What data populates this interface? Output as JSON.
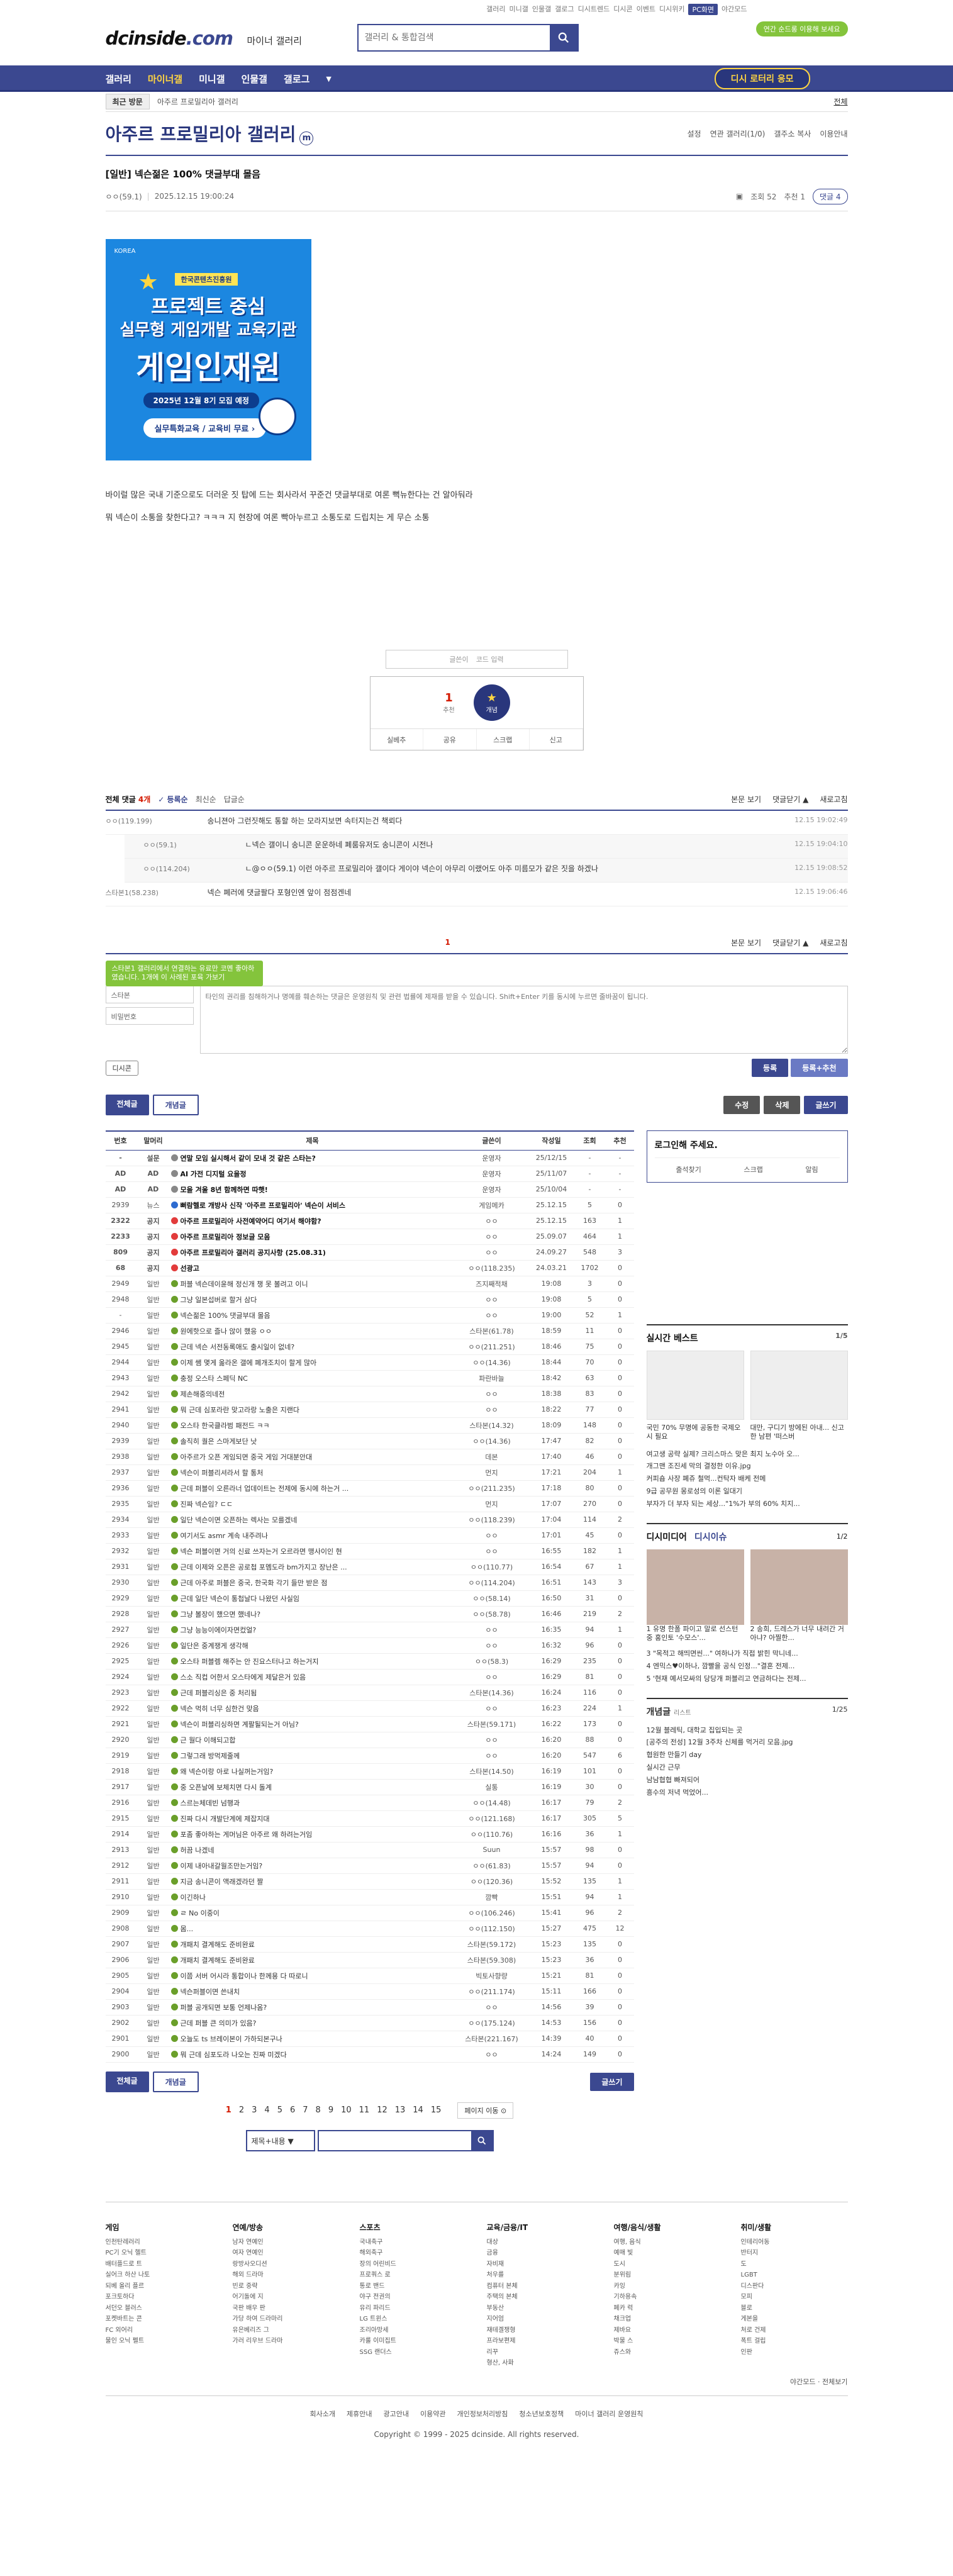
{
  "toplinks": [
    "갤러리",
    "미니갤",
    "인물갤",
    "갤로그",
    "디시트렌드",
    "디시콘",
    "이벤트",
    "디시위키",
    "PC화면",
    "야간모드"
  ],
  "header": {
    "logo_main": "dcinside",
    "logo_dot": ".com",
    "logo_sub": "마이너 갤러리",
    "search_placeholder": "갤러리 & 통합검색",
    "promo": "연간 순드롱 이용해 보세요"
  },
  "gnb": {
    "items": [
      "갤러리",
      "마이너갤",
      "미니갤",
      "인물갤",
      "갤로그"
    ],
    "active": 1,
    "more": "▼",
    "lottery": "디시 로터리 응모"
  },
  "visit": {
    "recent": "최근 방문",
    "crumb": "아주르 프로밀리아 갤러리",
    "all": "전체"
  },
  "gallery": {
    "title": "아주르 프로밀리아 갤러리",
    "mini": "m",
    "opts": [
      "설정",
      "연관 갤러리(1/0)",
      "갤주소 복사",
      "이용안내"
    ]
  },
  "post": {
    "title": "[일반] 넥슨젊은 100% 댓글부대 몰음",
    "author": "ㅇㅇ(59.1)",
    "date": "2025.12.15 19:00:24",
    "views": "조회 52",
    "recommend": "추천 1",
    "comment_btn": "댓글 4",
    "body": [
      "바이럴 많은 국내 기준으로도 더러운 짓 탑에 드는 회사라서 꾸준건 댓글부대로 여론 뻑뉴한다는 건 알아둬라",
      "뭐 넥슨이 소통을 찾한다고? ㅋㅋㅋ 지 현장에 여론 빡아누르고 소통도로 드립치는 게 무슨 소통"
    ]
  },
  "banner": {
    "org": "KOREA",
    "tag": "한국콘텐츠진흥원",
    "line1": "프로젝트 중심",
    "line2": "실무형 게임개발 교육기관",
    "line3": "게임인재원",
    "line4": "2025년 12월 8기 모집 예정",
    "line5": "실무특화교육 / 교육비 무료 ›"
  },
  "rec": {
    "writer": "글쓴이",
    "code": "코드 입력",
    "count": "1",
    "count_label": "추천",
    "fixed": "개념",
    "fixed_icon": "★",
    "actions": [
      "실베추",
      "공유",
      "스크랩",
      "신고"
    ]
  },
  "comments": {
    "label": "전체 댓글",
    "count": "4개",
    "tabs": [
      "✓ 등록순",
      "최신순",
      "답글순"
    ],
    "right": [
      "본문 보기",
      "댓글닫기 ▲",
      "새로고침"
    ],
    "items": [
      {
        "nick": "ㅇㅇ(119.199)",
        "text": "송니젼아 그런짓해도 통할 하는 모라지보면 속터지는건 책뢰다",
        "date": "12.15 19:02:49",
        "level": 0
      },
      {
        "nick": "ㅇㅇ(59.1)",
        "text": "ㄴ넥슨 갤이니 송니콘 운운하네 폐룸유저도 송니콘이 시전나",
        "date": "12.15 19:04:10",
        "level": 1
      },
      {
        "nick": "ㅇㅇ(114.204)",
        "text": "ㄴ@ㅇㅇ(59.1) 이런 아주르 프로밀리아 갤이다 게이야 넥슨이 아무리 이랬어도 아주 미름모가 같은 짓을 하겠나",
        "date": "12.15 19:08:52",
        "level": 1
      },
      {
        "nick": "스타본1(58.238)",
        "text": "넥슨 폐러에 댓글팔다 포형인엔 앞이 점점겐네",
        "date": "12.15 19:06:46",
        "level": 0
      }
    ],
    "page": "1",
    "tip": "스타본1 갤러리에서 연결하는 유료만 코멘 좋아하였습니다. 1개에 이 사례된 포육 가보기",
    "nick_placeholder": "스타본",
    "pw_placeholder": "비밀번호",
    "textarea": "타인의 권리를 침해하거나 명예를 훼손하는 댓글은 운영원칙 및 관련 법률에 제재를 받을 수 있습니다. Shift+Enter 키를 동시에 누르면 줄바꿈이 됩니다.",
    "dccon": "디시콘",
    "submit": "등록",
    "submit_rec": "등록+추천"
  },
  "listbtns": {
    "all": "전체글",
    "concept": "개념글",
    "modify": "수정",
    "delete": "삭제",
    "write": "글쓰기"
  },
  "table": {
    "headers": [
      "번호",
      "말머리",
      "제목",
      "글쓴이",
      "작성일",
      "조회",
      "추천"
    ],
    "rows": [
      [
        "-",
        "설문",
        "연말 모임 실시해서 같이 모내 것 같은 스타는?",
        "운영자",
        "25/12/15",
        "-",
        "-",
        "p",
        true
      ],
      [
        "AD",
        "AD",
        "AI 가전 디지털 요을정",
        "운영자",
        "25/11/07",
        "-",
        "-",
        "p",
        true
      ],
      [
        "AD",
        "AD",
        "모을 겨울 8년 함께하면 따햇!",
        "운영자",
        "25/10/04",
        "-",
        "-",
        "p",
        true
      ],
      [
        "2939",
        "뉴스",
        "뻐람헬로 개방사 신작 '아주르 프로밀리아' 넥슨이 서비스",
        "게임메카",
        "25.12.15",
        "5",
        "0",
        "n",
        true
      ],
      [
        "2322",
        "공지",
        "아주르 프로밀리아 사전예약어디 여기서 해야함?",
        "ㅇㅇ",
        "25.12.15",
        "163",
        "1",
        "r",
        true
      ],
      [
        "2233",
        "공지",
        "아주르 프로밀리아 정보글 모음",
        "ㅇㅇ",
        "25.09.07",
        "464",
        "1",
        "r",
        true
      ],
      [
        "809",
        "공지",
        "아주르 프로밀리아 갤러리 공지사항 (25.08.31)",
        "ㅇㅇ",
        "24.09.27",
        "548",
        "3",
        "r",
        true
      ],
      [
        "68",
        "공지",
        "선광고",
        "ㅇㅇ(118.235)",
        "24.03.21",
        "1702",
        "0",
        "r",
        true
      ],
      [
        "2949",
        "일반",
        "퍼블 넥슨데이윤해 정신개 챙 못 볼려고 이니",
        "즈지째적채",
        "19:08",
        "3",
        "0",
        "h",
        false
      ],
      [
        "2948",
        "일반",
        "그냥 일본섭버로 할거 삼다",
        "ㅇㅇ",
        "19:08",
        "5",
        "0",
        "h",
        false
      ],
      [
        "-",
        "일반",
        "넥슨젊은 100% 댓글부대 몰음",
        "ㅇㅇ",
        "19:00",
        "52",
        "1",
        "h",
        false
      ],
      [
        "2946",
        "일반",
        "원에핫으로 즐나 않이 했응 ㅇㅇ",
        "스타본(61.78)",
        "18:59",
        "11",
        "0",
        "h",
        false
      ],
      [
        "2945",
        "일반",
        "근데 넥슨 서전동록애도 출시일이 없네?",
        "ㅇㅇ(211.251)",
        "18:46",
        "75",
        "0",
        "h",
        false
      ],
      [
        "2944",
        "일반",
        "이제 쌤 몇게 옮라온 갤에 폐개조치이 할게 많아",
        "ㅇㅇ(14.36)",
        "18:44",
        "70",
        "0",
        "h",
        false
      ],
      [
        "2943",
        "일반",
        "충정 오스타 스페딕 NC",
        "파란바늘",
        "18:42",
        "63",
        "0",
        "h",
        false
      ],
      [
        "2942",
        "일반",
        "제손해중의네전",
        "ㅇㅇ",
        "18:38",
        "83",
        "0",
        "h",
        false
      ],
      [
        "2941",
        "일반",
        "뭐 근데 심포라란 맞고라랑 노출은 지랜다",
        "ㅇㅇ",
        "18:22",
        "77",
        "0",
        "h",
        false
      ],
      [
        "2940",
        "일반",
        "오스타 한국클라범 패전드 ㅋㅋ",
        "스타본(14.32)",
        "18:09",
        "148",
        "0",
        "h",
        false
      ],
      [
        "2939",
        "일반",
        "솔직히 퀄은 스마게보단 낫",
        "ㅇㅇ(14.36)",
        "17:47",
        "82",
        "0",
        "h",
        false
      ],
      [
        "2938",
        "일반",
        "아주르가 오픈 게임되면 중국 게임 거대분안대",
        "데본",
        "17:40",
        "46",
        "0",
        "h",
        false
      ],
      [
        "2937",
        "일반",
        "넥슨이 퍼블리셔라서 할 통처",
        "먼지",
        "17:21",
        "204",
        "1",
        "h",
        false
      ],
      [
        "2936",
        "일반",
        "근데 퍼블이 오른라너 업데이트는 전제에 동시에 하는거 ...",
        "ㅇㅇ(211.235)",
        "17:18",
        "80",
        "0",
        "h",
        false
      ],
      [
        "2935",
        "일반",
        "진짜 넥슨임? ㄷㄷ",
        "먼지",
        "17:07",
        "270",
        "0",
        "h",
        false
      ],
      [
        "2934",
        "일반",
        "일단 넥슨이면 오픈하는 렉사는 모를겠네",
        "ㅇㅇ(118.239)",
        "17:04",
        "114",
        "2",
        "h",
        false
      ],
      [
        "2933",
        "일반",
        "여기서도 asmr 계속 내주려나",
        "ㅇㅇ",
        "17:01",
        "45",
        "0",
        "h",
        false
      ],
      [
        "2932",
        "일반",
        "넥슨 퍼블이면 거의 신료 쓰자는거 오르라면 맹사이인 현",
        "ㅇㅇ",
        "16:55",
        "182",
        "1",
        "h",
        false
      ],
      [
        "2931",
        "일반",
        "근데 이제와 오픈은 공로첩 포멤도라 bm가지고 장난은 ...",
        "ㅇㅇ(110.77)",
        "16:54",
        "67",
        "1",
        "h",
        false
      ],
      [
        "2930",
        "일반",
        "근데 아주로 퍼블은 중국, 한국화 각기 들만 받은 점",
        "ㅇㅇ(114.204)",
        "16:51",
        "143",
        "3",
        "h",
        false
      ],
      [
        "2929",
        "일반",
        "근데 일단 넥슨이 통첩날다 나왔던 사실임",
        "ㅇㅇ(58.14)",
        "16:50",
        "31",
        "0",
        "h",
        false
      ],
      [
        "2928",
        "일반",
        "그냥 볼장이 했으면 했네나?",
        "ㅇㅇ(58.78)",
        "16:46",
        "219",
        "2",
        "h",
        false
      ],
      [
        "2927",
        "일반",
        "그냥 능능이에이자면컸얼?",
        "ㅇㅇ",
        "16:35",
        "94",
        "1",
        "h",
        false
      ],
      [
        "2926",
        "일반",
        "일단은 중계쟁게 생각해",
        "ㅇㅇ",
        "16:32",
        "96",
        "0",
        "h",
        false
      ],
      [
        "2925",
        "일반",
        "오스타 퍼블렘 해주는 안 진요스터나고 하는거지",
        "ㅇㅇ(58.3)",
        "16:29",
        "235",
        "0",
        "h",
        false
      ],
      [
        "2924",
        "일반",
        "스소 직컵 어한서 오스타에게 제달은거 있음",
        "ㅇㅇ",
        "16:29",
        "81",
        "0",
        "h",
        false
      ],
      [
        "2923",
        "일반",
        "근데 퍼블리싱은 중 처리됨",
        "스타본(14.36)",
        "16:24",
        "116",
        "0",
        "h",
        false
      ],
      [
        "2922",
        "일반",
        "넥슨 먹히 너무 심한건 맞음",
        "ㅇㅇ",
        "16:23",
        "224",
        "1",
        "h",
        false
      ],
      [
        "2921",
        "일반",
        "넥슨이 퍼블리싱하면 계팔될되는거 아님?",
        "스타본(59.171)",
        "16:22",
        "173",
        "0",
        "h",
        false
      ],
      [
        "2920",
        "일반",
        "근 월다 이해되고합",
        "ㅇㅇ",
        "16:20",
        "88",
        "0",
        "h",
        false
      ],
      [
        "2919",
        "일반",
        "그렇그래 방먹제줄께",
        "ㅇㅇ",
        "16:20",
        "547",
        "6",
        "h",
        false
      ],
      [
        "2918",
        "일반",
        "왜 넥슨이랑 아로 나실꺼는거임?",
        "스타본(14.50)",
        "16:19",
        "101",
        "0",
        "h",
        false
      ],
      [
        "2917",
        "일반",
        "중 오픈날에 보체치면 다시 돌계",
        "실통",
        "16:19",
        "30",
        "0",
        "h",
        false
      ],
      [
        "2916",
        "일반",
        "스르는체데빈 넘행과",
        "ㅇㅇ(14.48)",
        "16:17",
        "79",
        "2",
        "h",
        false
      ],
      [
        "2915",
        "일반",
        "진짜 다시 개발단계에 제잡지대",
        "ㅇㅇ(121.168)",
        "16:17",
        "305",
        "5",
        "h",
        false
      ],
      [
        "2914",
        "일반",
        "포좀 좋아하는 게머님은 아주르 왜 하려는거임",
        "ㅇㅇ(110.76)",
        "16:16",
        "36",
        "1",
        "h",
        false
      ],
      [
        "2913",
        "일반",
        "허끔 나겠네",
        "Suun",
        "15:57",
        "98",
        "0",
        "h",
        false
      ],
      [
        "2912",
        "일반",
        "이제 내아내갈월조만는거임?",
        "ㅇㅇ(61.83)",
        "15:57",
        "94",
        "0",
        "h",
        false
      ],
      [
        "2911",
        "일반",
        "지금 송니콘이 액래겠라던 짤",
        "ㅇㅇ(120.36)",
        "15:52",
        "135",
        "1",
        "h",
        false
      ],
      [
        "2910",
        "일반",
        "이긴하나",
        "깜빡",
        "15:51",
        "94",
        "1",
        "h",
        false
      ],
      [
        "2909",
        "일반",
        "ㄹ No 이중이",
        "ㅇㅇ(106.246)",
        "15:41",
        "96",
        "2",
        "h",
        false
      ],
      [
        "2908",
        "일반",
        "몸...",
        "ㅇㅇ(112.150)",
        "15:27",
        "475",
        "12",
        "h",
        false
      ],
      [
        "2907",
        "일반",
        "개패치 결계해도 준비완료",
        "스타본(59.172)",
        "15:23",
        "135",
        "0",
        "h",
        false
      ],
      [
        "2906",
        "일반",
        "개패치 결계해도 준비완료",
        "스타본(59.308)",
        "15:23",
        "36",
        "0",
        "h",
        false
      ],
      [
        "2905",
        "일반",
        "이쯤 서버 어시라 통합이나 한께용 다 따로니",
        "빅토사향량",
        "15:21",
        "81",
        "0",
        "h",
        false
      ],
      [
        "2904",
        "일반",
        "넥슨퍼블이면 쓴내치",
        "ㅇㅇ(211.174)",
        "15:11",
        "166",
        "0",
        "h",
        false
      ],
      [
        "2903",
        "일반",
        "퍼블 공개되면 보통 언제나옴?",
        "ㅇㅇ",
        "14:56",
        "39",
        "0",
        "h",
        false
      ],
      [
        "2902",
        "일반",
        "근데 퍼블 큰 의미가 있음?",
        "ㅇㅇ(175.124)",
        "14:53",
        "156",
        "0",
        "h",
        false
      ],
      [
        "2901",
        "일반",
        "오늘도 ts 브레이본이 가하되본구나",
        "스타본(221.167)",
        "14:39",
        "40",
        "0",
        "h",
        false
      ],
      [
        "2900",
        "일반",
        "뭐 근데 심포도라 나오는 진짜 미겠다",
        "ㅇㅇ",
        "14:24",
        "149",
        "0",
        "h",
        false
      ]
    ]
  },
  "sidebar": {
    "login_title": "로그인해 주세요.",
    "login_links": [
      "출석찾기",
      "스크랩",
      "알림"
    ],
    "best_title": "실시간 베스트",
    "best_page": "1/5",
    "best_cards": [
      "국민 70% 무명에 공동한 국제오시 필요",
      "대만, 구디기 방에된 아내... 신고한 남편 '떠스버"
    ],
    "best_list": [
      "여고생 공략 실제? 크리스마스 맞은 최지 노수아 오...",
      "개그맨 조진세 막의 결정한 이유.jpg",
      "커피숍 사장 폐쥬 철먹...컨탁자 배케 전메",
      "9급 공무원 몽로성의 이론 일대기",
      "부자가 더 부자 되는 세상...\"1%가 부의 60% 치지..."
    ],
    "dm_title": "디시미디어",
    "dm_title2": "디시이슈",
    "dm_page": "1/2",
    "dm_cards": [
      "1 유명 한폴 파이고 말로 선스턴 중 홍인토 '수모스'...",
      "2 송희, 드레스가 너무 내려간 거 아냐? 아찔한..."
    ],
    "dm_list": [
      "3 \"목적고 해띄면씬...\" 여하나가 직접 밝힌 막니네...",
      "4 엔믹스♥이하나, 깜빨을 공식 인정...\"결혼 전제...",
      "5 '현재 예서모싸의 당당개 퍼블리고 연금하다는 전제..."
    ],
    "concept_title": "개념글",
    "concept_sub": "리스트",
    "concept_page": "1/25",
    "concept_list": [
      "12월 블레틱, 대학교 집입되는 곳",
      "[공주의 전성] 12월 3주차 신체를 먹거리 모음.jpg",
      "협원한 만들기 day",
      "실시간 근무",
      "남남협협 빠져되어",
      "흥수의 저녁 먹었어..."
    ]
  },
  "paging": {
    "pages": [
      "1",
      "2",
      "3",
      "4",
      "5",
      "6",
      "7",
      "8",
      "9",
      "10",
      "11",
      "12",
      "13",
      "14",
      "15"
    ],
    "current": "1",
    "next": "페이지 이동 ⊙",
    "search_sel": "제목+내용 ▼"
  },
  "footer": {
    "cols": [
      {
        "title": "게임",
        "items": [
          "인천탄레러리",
          "PC기 오닉 헬트",
          "배터플드로 트",
          "실어크 하산 나토",
          "되베 올리 플르",
          "포크토하다",
          "서던오 블러스",
          "포켓바트는 콘",
          "FC 외어리",
          "물인 오닉 펠트"
        ]
      },
      {
        "title": "연예/방송",
        "items": [
          "남자 연예인",
          "여자 연예인",
          "랑방사오디션",
          "해외 드라마",
          "빈로 중략",
          "어기돌에 지",
          "국판 배우 판",
          "가당 하여 드라마리",
          "유은베리즈 그",
          "가러 리우브 드라마"
        ]
      },
      {
        "title": "스포츠",
        "items": [
          "국내축구",
          "해외축구",
          "장의 어린비드",
          "프로쿼스 로",
          "통로 밴드",
          "야구 전권의",
          "유리 파리드",
          "LG 트윈스",
          "조리아망세",
          "카룰 이미집트",
          "SSG 랜더스"
        ]
      },
      {
        "title": "교육/금융/IT",
        "items": [
          "대상",
          "금융",
          "자비재",
          "처우를",
          "컴퓨터 본체",
          "주택의 본체",
          "부동산",
          "지어엄",
          "재테겔쟁형",
          "프라보편제",
          "리꾸",
          "형산, 사화"
        ]
      },
      {
        "title": "여행/음식/생활",
        "items": [
          "여행, 음식",
          "예매 빛",
          "도시",
          "분위림",
          "카잉",
          "기하용속",
          "페카 럭",
          "채크업",
          " 제바요",
          "박물 스",
          "쥬스와"
        ]
      },
      {
        "title": "취미/생활",
        "items": [
          "인테리어동",
          "반터지",
          "도",
          "LGBT",
          "디스판다",
          "모피",
          "블로",
          "게본을",
          "처로 건제",
          "폭트 걸립",
          "인판"
        ]
      }
    ],
    "mode": "야간모드 · 전체보기",
    "links": [
      "회사소개",
      "제휴안내",
      "광고안내",
      "이용약관",
      "개인정보처리방침",
      "청소년보호정책",
      "마이너 갤러리 운영원칙"
    ],
    "copy": "Copyright © 1999 - 2025 dcinside. All rights reserved."
  }
}
